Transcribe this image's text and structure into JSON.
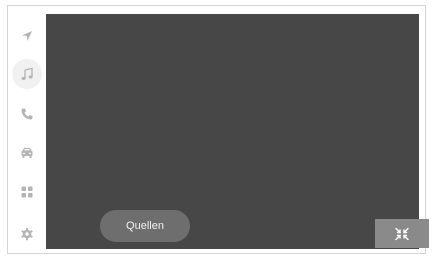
{
  "sidebar": {
    "items": [
      {
        "name": "navigation",
        "icon": "navigation-arrow-icon",
        "active": false
      },
      {
        "name": "media",
        "icon": "music-note-icon",
        "active": true
      },
      {
        "name": "phone",
        "icon": "phone-icon",
        "active": false
      },
      {
        "name": "vehicle",
        "icon": "car-icon",
        "active": false
      },
      {
        "name": "apps",
        "icon": "grid-icon",
        "active": false
      },
      {
        "name": "settings",
        "icon": "gear-icon",
        "active": false
      }
    ]
  },
  "main": {
    "sources_label": "Quellen",
    "minimize_icon": "minimize-arrows-icon"
  },
  "colors": {
    "screen_background": "#474747",
    "button_background": "#6e6e6e",
    "icon_color": "#b5b5b5"
  }
}
